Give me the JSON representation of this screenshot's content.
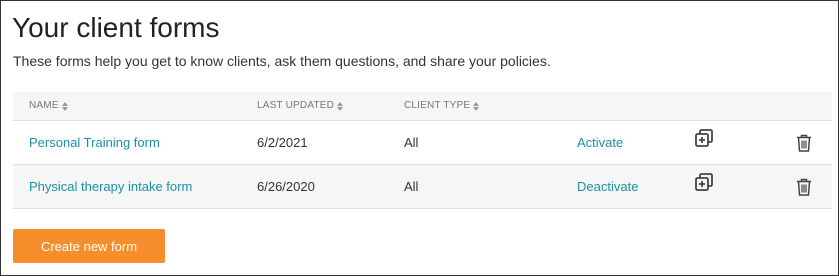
{
  "page": {
    "title": "Your client forms",
    "subtitle": "These forms help you get to know clients, ask them questions, and share your policies."
  },
  "table": {
    "headers": {
      "name": "NAME",
      "last_updated": "LAST UPDATED",
      "client_type": "CLIENT TYPE"
    },
    "rows": [
      {
        "name": "Personal Training form",
        "last_updated": "6/2/2021",
        "client_type": "All",
        "action": "Activate"
      },
      {
        "name": "Physical therapy intake form",
        "last_updated": "6/26/2020",
        "client_type": "All",
        "action": "Deactivate"
      }
    ]
  },
  "actions": {
    "create_label": "Create new form"
  },
  "colors": {
    "accent": "#f68e2b",
    "link": "#1f8fa6",
    "row_alt": "#f5f6f6"
  },
  "icons": {
    "sort": "sort-icon",
    "duplicate": "duplicate-icon",
    "delete": "trash-icon"
  }
}
